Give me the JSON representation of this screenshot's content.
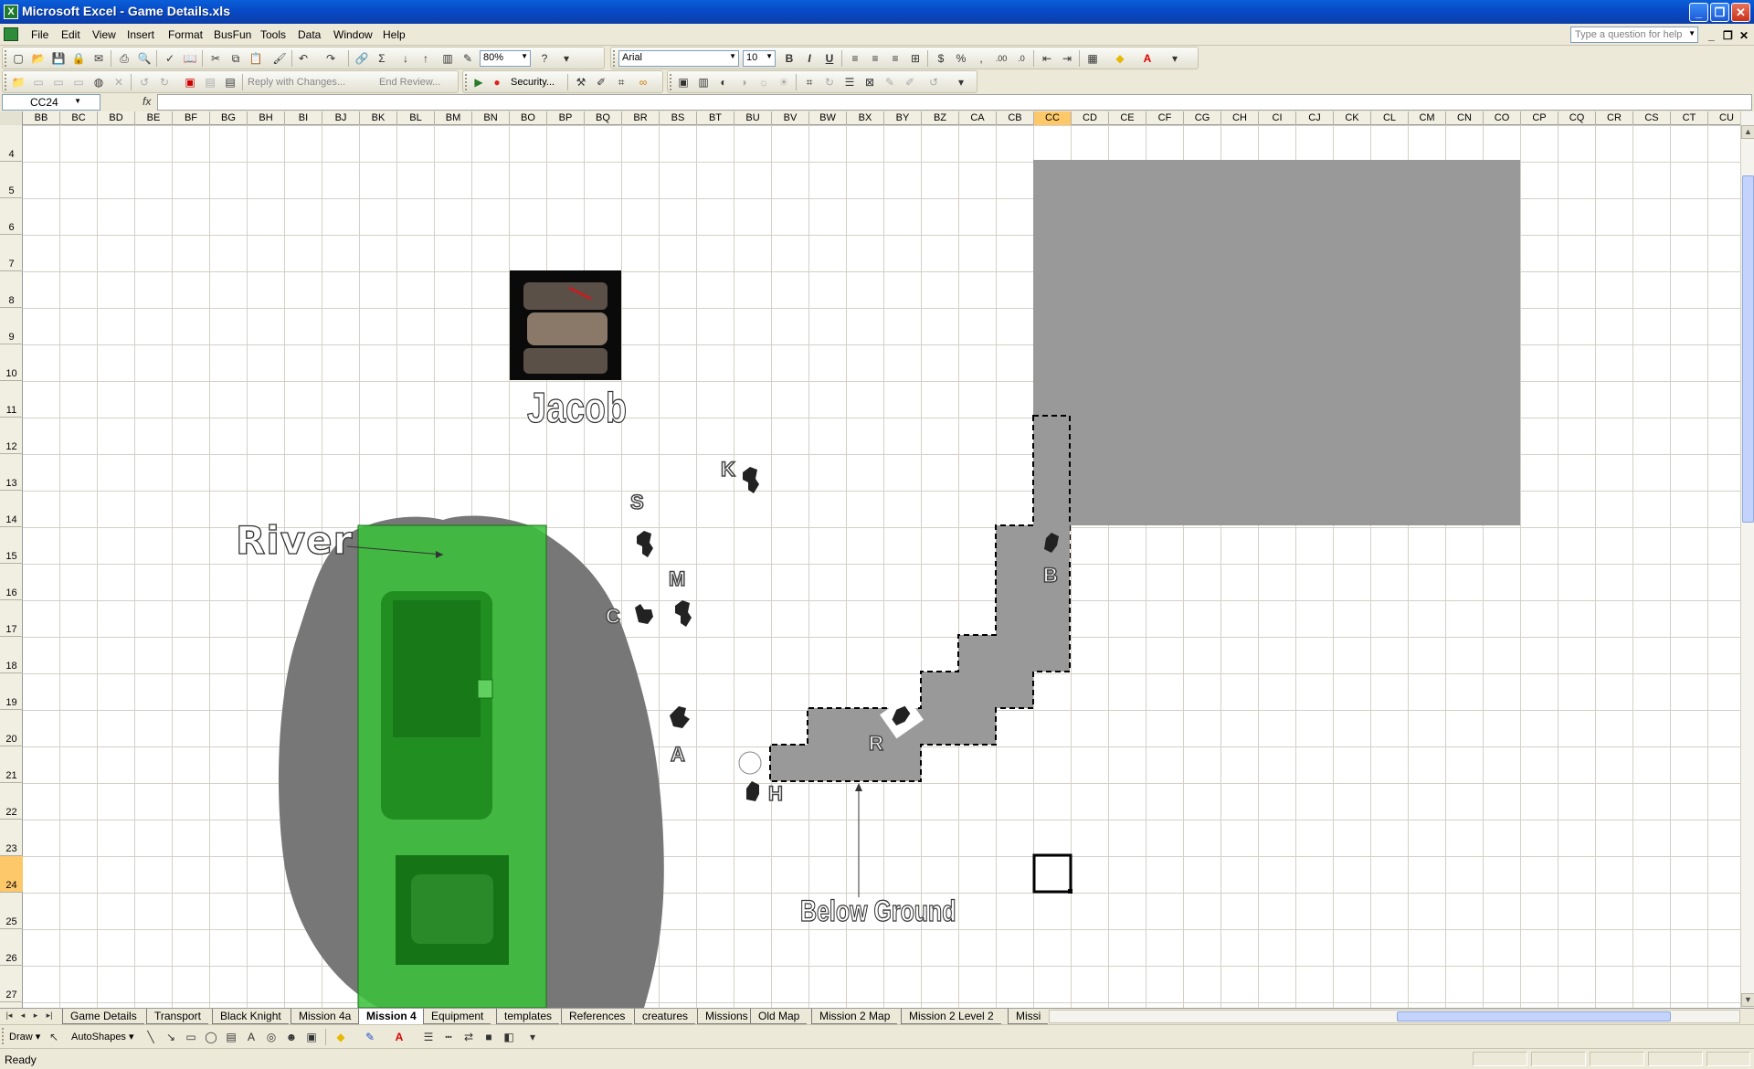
{
  "window": {
    "title": "Microsoft Excel - Game Details.xls",
    "app_icon": "X"
  },
  "menu": [
    "File",
    "Edit",
    "View",
    "Insert",
    "Format",
    "BusFun",
    "Tools",
    "Data",
    "Window",
    "Help"
  ],
  "help_placeholder": "Type a question for help",
  "toolbar": {
    "zoom": "80%",
    "font_name": "Arial",
    "font_size": "10",
    "reply_with_changes": "Reply with Changes...",
    "end_review": "End Review...",
    "security": "Security..."
  },
  "formula_bar": {
    "name_box": "CC24",
    "fx": "fx",
    "value": ""
  },
  "columns": [
    "BB",
    "BC",
    "BD",
    "BE",
    "BF",
    "BG",
    "BH",
    "BI",
    "BJ",
    "BK",
    "BL",
    "BM",
    "BN",
    "BO",
    "BP",
    "BQ",
    "BR",
    "BS",
    "BT",
    "BU",
    "BV",
    "BW",
    "BX",
    "BY",
    "BZ",
    "CA",
    "CB",
    "CC",
    "CD",
    "CE",
    "CF",
    "CG",
    "CH",
    "CI",
    "CJ",
    "CK",
    "CL",
    "CM",
    "CN",
    "CO",
    "CP",
    "CQ",
    "CR",
    "CS",
    "CT",
    "CU"
  ],
  "selected_column": "CC",
  "rows": [
    "4",
    "5",
    "6",
    "7",
    "8",
    "9",
    "10",
    "11",
    "12",
    "13",
    "14",
    "15",
    "16",
    "17",
    "18",
    "19",
    "20",
    "21",
    "22",
    "23",
    "24",
    "25",
    "26",
    "27"
  ],
  "selected_row": "24",
  "map": {
    "river_label": "River",
    "jacob_label": "Jacob",
    "below_ground_label": "Below Ground",
    "unit_labels": {
      "k": "K",
      "s": "S",
      "m": "M",
      "c": "C",
      "a": "A",
      "h": "H",
      "r": "R",
      "b": "B"
    }
  },
  "sheets": [
    "Game Details",
    "Transport",
    "Black Knight",
    "Mission 4a",
    "Mission 4",
    "Equipment",
    "templates",
    "References",
    "creatures",
    "Missions",
    "Old Map",
    "Mission 2 Map",
    "Mission 2 Level 2",
    "Missi"
  ],
  "active_sheet": "Mission 4",
  "drawing": {
    "draw": "Draw",
    "autoshapes": "AutoShapes"
  },
  "status": "Ready"
}
